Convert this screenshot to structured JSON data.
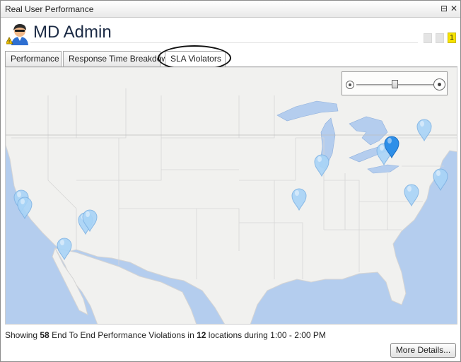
{
  "window": {
    "title": "Real User Performance",
    "restore_glyph": "⊟",
    "close_glyph": "✕"
  },
  "header": {
    "title": "MD Admin",
    "avatar_icon": "admin-user-warning-icon",
    "alert_count": "1"
  },
  "tabs": [
    {
      "label": "Performance",
      "active": false
    },
    {
      "label": "Response Time Breakdown",
      "active": false
    },
    {
      "label": "SLA Violators",
      "active": true
    }
  ],
  "map": {
    "region": "United States",
    "zoom": {
      "level": 0.5
    },
    "pins": [
      {
        "location": "San Francisco",
        "selected": false
      },
      {
        "location": "San Jose",
        "selected": false
      },
      {
        "location": "Los Angeles",
        "selected": false
      },
      {
        "location": "Phoenix",
        "selected": false
      },
      {
        "location": "Las Vegas",
        "selected": false
      },
      {
        "location": "St. Louis",
        "selected": false
      },
      {
        "location": "Chicago",
        "selected": false
      },
      {
        "location": "Toronto",
        "selected": false
      },
      {
        "location": "Buffalo",
        "selected": true
      },
      {
        "location": "Montreal",
        "selected": false
      },
      {
        "location": "Washington DC",
        "selected": false
      },
      {
        "location": "New York",
        "selected": false
      }
    ]
  },
  "status": {
    "prefix": "Showing ",
    "count": "58",
    "middle": " End To End Performance Violations in ",
    "locations": "12",
    "suffix": " locations during 1:00 - 2:00 PM"
  },
  "buttons": {
    "more_details": "More Details..."
  },
  "colors": {
    "water": "#b4cdee",
    "land": "#f1f1ef",
    "pin": "#a8d4f7",
    "pin_selected": "#2e8fe8",
    "badge": "#f7e300"
  }
}
